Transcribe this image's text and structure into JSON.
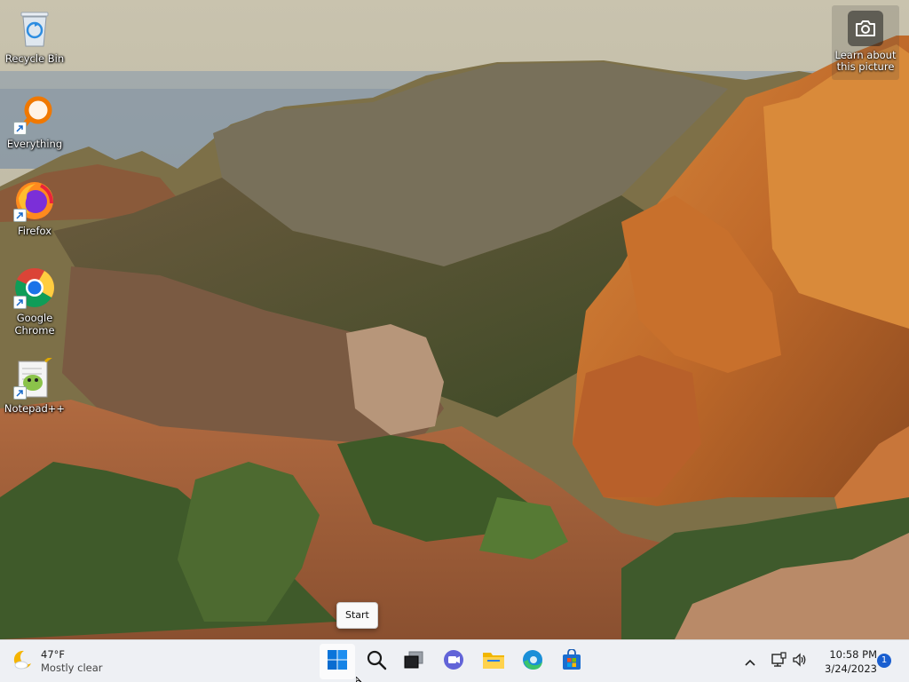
{
  "desktop": {
    "icons": [
      {
        "label": "Recycle Bin",
        "icon": "recycle-bin-icon"
      },
      {
        "label": "Everything",
        "icon": "everything-search-icon"
      },
      {
        "label": "Firefox",
        "icon": "firefox-icon"
      },
      {
        "label": "Google Chrome",
        "icon": "chrome-icon"
      },
      {
        "label": "Notepad++",
        "icon": "notepad-plus-plus-icon"
      }
    ],
    "learn_about": {
      "label": "Learn about this picture",
      "icon": "camera-icon"
    }
  },
  "tooltip": {
    "text": "Start"
  },
  "taskbar": {
    "weather": {
      "temperature": "47°F",
      "description": "Mostly clear",
      "icon": "weather-moon-icon"
    },
    "apps": [
      {
        "name": "Start",
        "icon": "windows-start-icon"
      },
      {
        "name": "Search",
        "icon": "search-icon"
      },
      {
        "name": "Task View",
        "icon": "task-view-icon"
      },
      {
        "name": "Chat",
        "icon": "teams-chat-icon"
      },
      {
        "name": "File Explorer",
        "icon": "file-explorer-icon"
      },
      {
        "name": "Microsoft Edge",
        "icon": "edge-icon"
      },
      {
        "name": "Microsoft Store",
        "icon": "store-icon"
      }
    ],
    "tray": {
      "icons": [
        "chevron-up-icon",
        "network-icon",
        "volume-icon"
      ],
      "time": "10:58 PM",
      "date": "3/24/2023",
      "notification_count": "1"
    }
  },
  "colors": {
    "accent": "#0067c0",
    "taskbar_bg": "#eef0f4",
    "notification_badge": "#1a5fd0"
  }
}
